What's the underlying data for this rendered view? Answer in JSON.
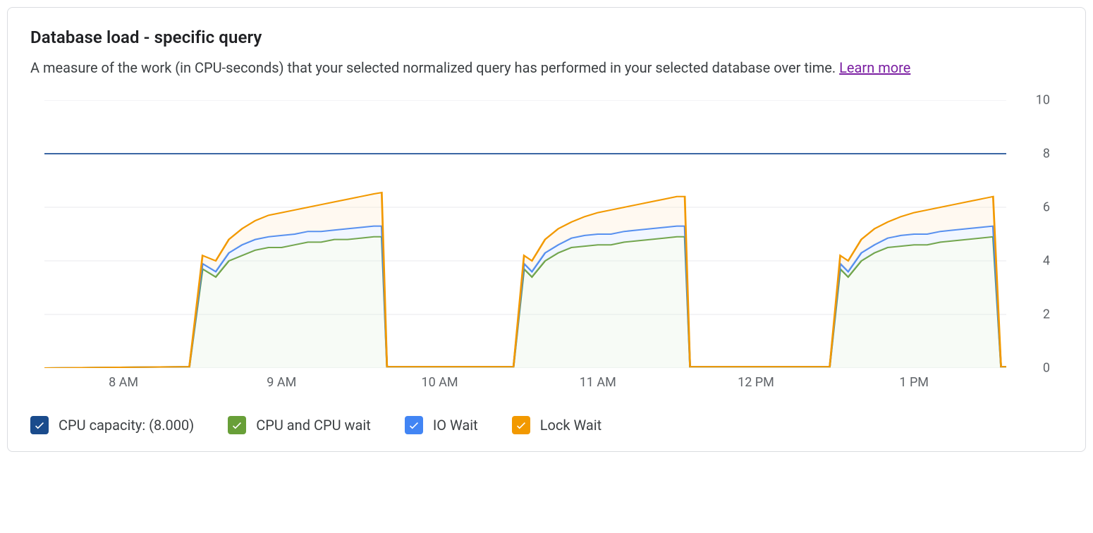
{
  "header": {
    "title": "Database load - specific query",
    "subtitle_prefix": "A measure of the work (in CPU-seconds) that your selected normalized query has performed in your selected database over time. ",
    "learn_more": "Learn more"
  },
  "legend": {
    "capacity": "CPU capacity: (8.000)",
    "cpu": "CPU and CPU wait",
    "io": "IO Wait",
    "lock": "Lock Wait"
  },
  "colors": {
    "capacity": "#3b66a3",
    "cpu_fill": "#dfeedb",
    "cpu_line": "#689f38",
    "io_fill": "#c9dbff",
    "io_line": "#4285f4",
    "lock_fill": "#ffe7c7",
    "lock_line": "#f29900",
    "chk_capacity": "#1a4b8c",
    "chk_cpu": "#689f38",
    "chk_io": "#4285f4",
    "chk_lock": "#f29900"
  },
  "chart_data": {
    "type": "area",
    "title": "Database load - specific query",
    "xlabel": "",
    "ylabel": "",
    "ylim": [
      0,
      10
    ],
    "y_ticks": [
      0,
      2,
      4,
      6,
      8,
      10
    ],
    "x_categories": [
      "8 AM",
      "9 AM",
      "10 AM",
      "11 AM",
      "12 PM",
      "1 PM"
    ],
    "x_range_minutes": [
      450,
      815
    ],
    "capacity_line": 8.0,
    "series": [
      {
        "name": "CPU and CPU wait",
        "color": "#689f38"
      },
      {
        "name": "IO Wait",
        "color": "#4285f4"
      },
      {
        "name": "Lock Wait",
        "color": "#f29900"
      }
    ],
    "sample_minutes": [
      450,
      505,
      510,
      515,
      520,
      525,
      530,
      535,
      540,
      545,
      550,
      555,
      560,
      565,
      570,
      575,
      578,
      580,
      585,
      628,
      632,
      635,
      640,
      645,
      650,
      655,
      660,
      665,
      670,
      675,
      680,
      685,
      690,
      693,
      695,
      700,
      748,
      752,
      755,
      760,
      765,
      770,
      775,
      780,
      785,
      790,
      795,
      800,
      805,
      810,
      813,
      815
    ],
    "stacked_values": {
      "cpu": [
        0,
        0.05,
        3.7,
        3.4,
        4.0,
        4.2,
        4.4,
        4.5,
        4.5,
        4.6,
        4.7,
        4.7,
        4.8,
        4.8,
        4.85,
        4.9,
        4.9,
        0.05,
        0.05,
        0.05,
        3.7,
        3.4,
        4.0,
        4.3,
        4.5,
        4.55,
        4.6,
        4.6,
        4.7,
        4.75,
        4.8,
        4.85,
        4.9,
        4.9,
        0.05,
        0.05,
        0.05,
        3.7,
        3.4,
        4.0,
        4.3,
        4.5,
        4.55,
        4.6,
        4.6,
        4.7,
        4.75,
        4.8,
        4.85,
        4.9,
        0.05,
        0.05
      ],
      "io": [
        0,
        0.05,
        3.9,
        3.6,
        4.3,
        4.6,
        4.8,
        4.9,
        4.95,
        5.0,
        5.1,
        5.1,
        5.15,
        5.2,
        5.25,
        5.3,
        5.3,
        0.05,
        0.05,
        0.05,
        3.9,
        3.6,
        4.3,
        4.6,
        4.85,
        4.95,
        5.0,
        5.0,
        5.1,
        5.15,
        5.2,
        5.25,
        5.3,
        5.3,
        0.05,
        0.05,
        0.05,
        3.9,
        3.6,
        4.3,
        4.6,
        4.85,
        4.95,
        5.0,
        5.0,
        5.1,
        5.15,
        5.2,
        5.25,
        5.3,
        0.05,
        0.05
      ],
      "lock": [
        0,
        0.05,
        4.2,
        4.0,
        4.8,
        5.2,
        5.5,
        5.7,
        5.8,
        5.9,
        6.0,
        6.1,
        6.2,
        6.3,
        6.4,
        6.5,
        6.55,
        0.05,
        0.05,
        0.05,
        4.2,
        4.0,
        4.8,
        5.2,
        5.45,
        5.65,
        5.8,
        5.9,
        6.0,
        6.1,
        6.2,
        6.3,
        6.4,
        6.4,
        0.05,
        0.05,
        0.05,
        4.2,
        4.0,
        4.8,
        5.2,
        5.45,
        5.65,
        5.8,
        5.9,
        6.0,
        6.1,
        6.2,
        6.3,
        6.4,
        0.05,
        0.05
      ]
    }
  }
}
